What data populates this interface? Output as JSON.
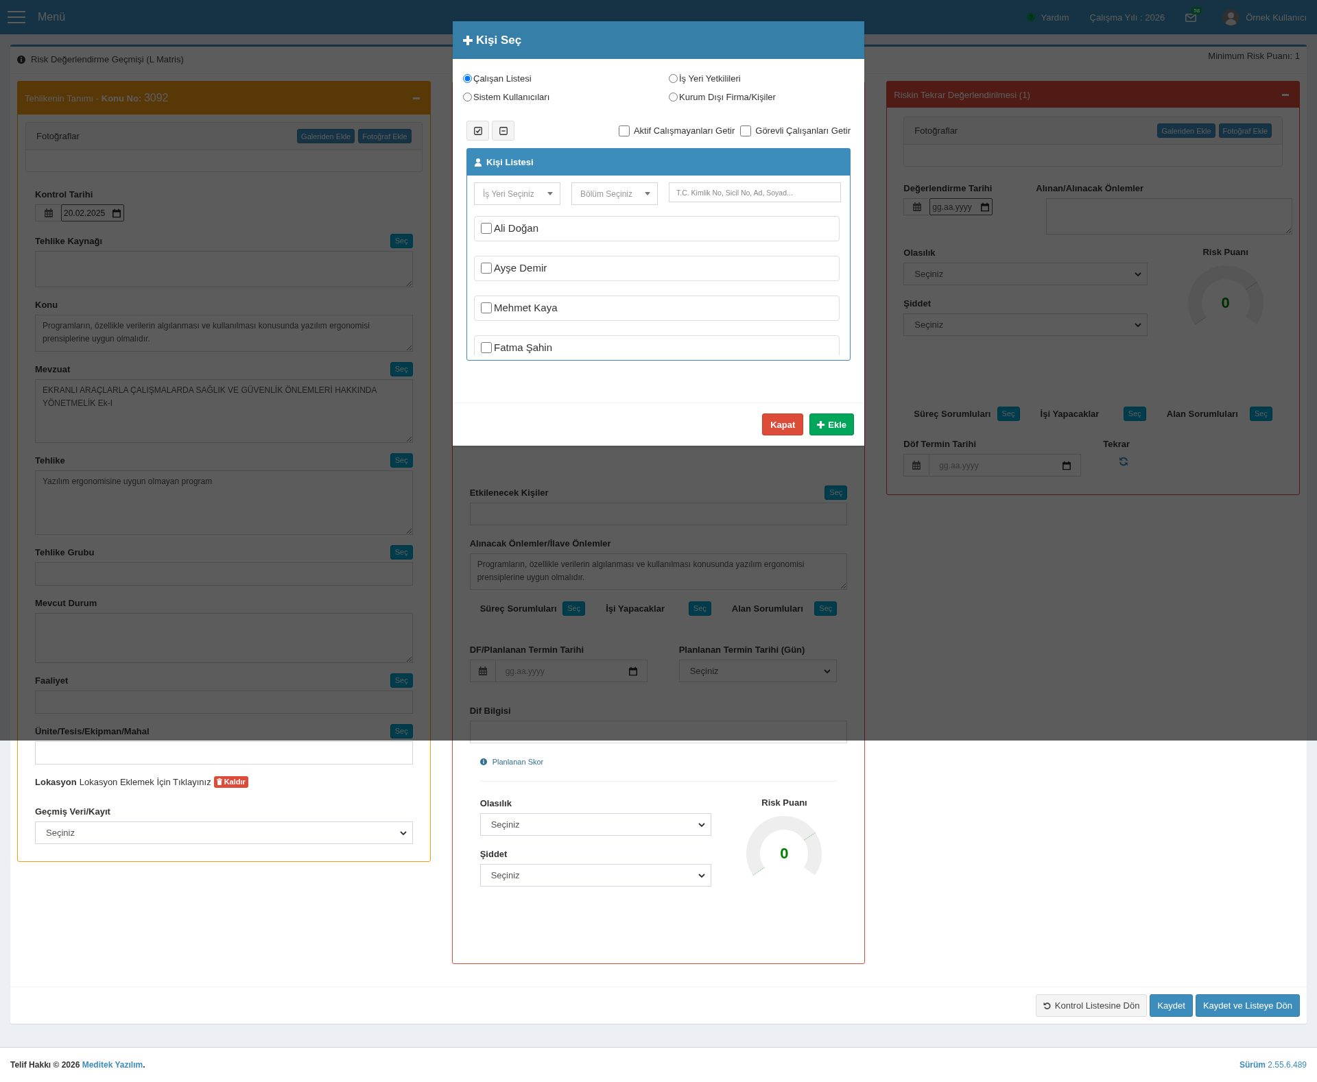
{
  "navbar": {
    "menu_label": "Menü",
    "help": "Yardım",
    "work_year": "Çalışma Yılı : 2026",
    "message_count": "58",
    "user": "Örnek Kullanıcı"
  },
  "page_header": {
    "title": "Risk Değerlendirme Geçmişi (L Matris)",
    "min_score": "Minimum Risk Puanı: 1"
  },
  "hazard_panel": {
    "title": "Tehlikenin Tanımı - **Konu No:**",
    "number": "3092",
    "photos": {
      "title": "Fotoğraflar",
      "buttons": [
        "Galeriden Ekle",
        "Fotoğraf Ekle"
      ]
    },
    "fields": [
      {
        "kind": "date",
        "label": "Kontrol Tarihi",
        "value": "20.02.2025"
      },
      {
        "kind": "textarea",
        "label": "Tehlike Kaynağı",
        "button": "Seç"
      },
      {
        "kind": "textarea",
        "label": "Konu",
        "value": "Programların, özellikle verilerin algılanması ve kullanılması konusunda yazılım ergonomisi prensiplerine uygun olmalıdır."
      },
      {
        "kind": "textarea",
        "label": "Mevzuat",
        "button": "Seç",
        "value": "EKRANLI ARAÇLARLA ÇALIŞMALARDA SAĞLIK VE GÜVENLİK ÖNLEMLERİ HAKKINDA YÖNETMELİK Ek-I"
      },
      {
        "kind": "textarea",
        "label": "Tehlike",
        "button": "Seç",
        "value": "Yazılım ergonomisine uygun olmayan program"
      },
      {
        "kind": "input",
        "label": "Tehlike Grubu",
        "button": "Seç"
      },
      {
        "kind": "textarea",
        "label": "Mevcut Durum"
      },
      {
        "kind": "input",
        "label": "Faaliyet",
        "button": "Seç"
      },
      {
        "kind": "input",
        "label": "Ünite/Tesis/Ekipman/Mahal",
        "button": "Seç"
      },
      {
        "kind": "location",
        "label": "Lokasyon",
        "link": "Lokasyon Eklemek İçin Tıklayınız",
        "button": "Kaldır"
      },
      {
        "kind": "select",
        "label": "Geçmiş Veri/Kayıt",
        "value": "Seçiniz"
      }
    ]
  },
  "action_panel": {
    "fields": [
      {
        "kind": "input",
        "label": "Etkilenecek Kişiler",
        "button": "Seç"
      },
      {
        "kind": "textarea",
        "label": "Alınacak Önlemler/İlave Önlemler",
        "value": "Programların, özellikle verilerin algılanması ve kullanılması konusunda yazılım ergonomisi prensiplerine uygun olmalıdır."
      }
    ],
    "responsibles": [
      {
        "label": "Süreç Sorumluları",
        "button": "Seç"
      },
      {
        "label": "İşi Yapacaklar",
        "button": "Seç"
      },
      {
        "label": "Alan Sorumluları",
        "button": "Seç"
      }
    ],
    "deadline": {
      "label": "DF/Planlanan Termin Tarihi",
      "placeholder": "gg.aa.yyyy"
    },
    "deadline_days": {
      "label": "Planlanan Termin Tarihi (Gün)",
      "value": "Seçiniz"
    },
    "dif_info": {
      "label": "Dif Bilgisi"
    },
    "note": "Planlanan Skor",
    "score": {
      "probability": {
        "label": "Olasılık",
        "value": "Seçiniz"
      },
      "severity": {
        "label": "Şiddet",
        "value": "Seçiniz"
      },
      "risk": {
        "label": "Risk Puanı",
        "value": "0"
      }
    }
  },
  "reassessment_panel": {
    "title": "Riskin Tekrar Değerlendirilmesi (1)",
    "photos": {
      "title": "Fotoğraflar",
      "buttons": [
        "Galeriden Ekle",
        "Fotoğraf Ekle"
      ]
    },
    "date": {
      "label": "Değerlendirme Tarihi",
      "placeholder": "gg.aa.yyyy"
    },
    "measures": {
      "label": "Alınan/Alınacak Önlemler"
    },
    "score": {
      "probability": {
        "label": "Olasılık",
        "value": "Seçiniz"
      },
      "severity": {
        "label": "Şiddet",
        "value": "Seçiniz"
      },
      "risk": {
        "label": "Risk Puanı",
        "value": "0"
      }
    },
    "responsibles": [
      {
        "label": "Süreç Sorumluları",
        "button": "Seç"
      },
      {
        "label": "İşi Yapacaklar",
        "button": "Seç"
      },
      {
        "label": "Alan Sorumluları",
        "button": "Seç"
      }
    ],
    "dof_date": {
      "label": "Döf Termin Tarihi",
      "placeholder": "gg.aa.yyyy"
    },
    "repeat": {
      "label": "Tekrar"
    }
  },
  "actions": [
    {
      "kind": "back",
      "label": "Kontrol Listesine Dön"
    },
    {
      "kind": "primary",
      "label": "Kaydet"
    },
    {
      "kind": "primary",
      "label": "Kaydet ve Listeye Dön"
    }
  ],
  "footer": {
    "copyright": "Telif Hakkı © 2026",
    "company": "Meditek Yazılım",
    "suffix": ".",
    "version": "**Sürüm** 2.55.6.489"
  },
  "modal": {
    "title": "Kişi Seç",
    "sources": [
      {
        "label": "Çalışan Listesi",
        "selected": true
      },
      {
        "label": "İş Yeri Yetkilileri",
        "selected": false
      },
      {
        "label": "Sistem Kullanıcıları",
        "selected": false
      },
      {
        "label": "Kurum Dışı Firma/Kişiler",
        "selected": false
      }
    ],
    "options": [
      {
        "label": "Aktif Calışmayanları Getir",
        "checked": false
      },
      {
        "label": "Görevli Çalışanları Getir",
        "checked": false
      }
    ],
    "list": {
      "title": "Kişi Listesi",
      "workplace": "İş Yeri Seçiniz",
      "department": "Bölüm Seçiniz",
      "search_placeholder": "T.C. Kimlik No, Sicil No, Ad, Soyad...",
      "people": [
        {
          "name": "Ali Doğan",
          "checked": false
        },
        {
          "name": "Ayşe Demir",
          "checked": false
        },
        {
          "name": "Mehmet Kaya",
          "checked": false
        },
        {
          "name": "Fatma Şahin",
          "checked": false
        }
      ]
    },
    "close": "Kapat",
    "add": "Ekle"
  }
}
